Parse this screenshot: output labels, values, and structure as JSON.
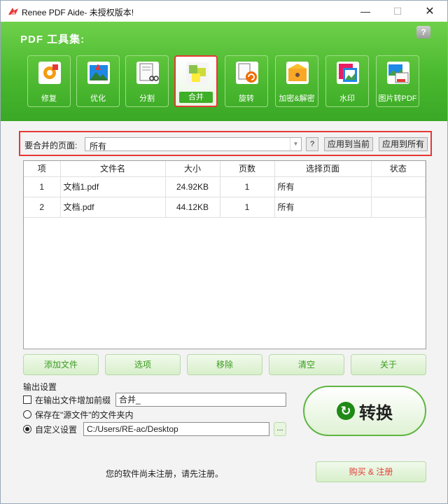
{
  "window": {
    "title": "Renee PDF Aide- 未授权版本!",
    "min_glyph": "—",
    "max_glyph": "☐",
    "close_glyph": "✕"
  },
  "header": {
    "title": "PDF 工具集:",
    "help": "?"
  },
  "tools": [
    {
      "label": "修复",
      "icon": "repair-icon",
      "active": false
    },
    {
      "label": "优化",
      "icon": "optimize-icon",
      "active": false
    },
    {
      "label": "分割",
      "icon": "split-icon",
      "active": false
    },
    {
      "label": "合并",
      "icon": "merge-icon",
      "active": true
    },
    {
      "label": "旋转",
      "icon": "rotate-icon",
      "active": false
    },
    {
      "label": "加密&解密",
      "icon": "encrypt-icon",
      "active": false
    },
    {
      "label": "水印",
      "icon": "watermark-icon",
      "active": false
    },
    {
      "label": "图片转PDF",
      "icon": "image-to-pdf-icon",
      "active": false
    }
  ],
  "pages_to_merge": {
    "label": "要合并的页面:",
    "value": "所有",
    "help": "?",
    "apply_current": "应用到当前",
    "apply_all": "应用到所有"
  },
  "file_table": {
    "columns": [
      "项",
      "文件名",
      "大小",
      "页数",
      "选择页面",
      "状态"
    ],
    "rows": [
      {
        "index": "1",
        "name": "文档1.pdf",
        "size": "24.92KB",
        "pages": "1",
        "selected_pages": "所有",
        "status": ""
      },
      {
        "index": "2",
        "name": "文档.pdf",
        "size": "44.12KB",
        "pages": "1",
        "selected_pages": "所有",
        "status": ""
      }
    ]
  },
  "actions": {
    "add_file": "添加文件",
    "options": "选项",
    "remove": "移除",
    "clear": "清空",
    "about": "关于"
  },
  "output": {
    "title": "输出设置",
    "prefix_label": "在输出文件增加前缀",
    "prefix_value": "合并_",
    "save_source_label": "保存在\"源文件\"的文件夹内",
    "custom_label": "自定义设置",
    "custom_path": "C:/Users/RE-ac/Desktop",
    "browse": "..."
  },
  "convert": {
    "label": "转换"
  },
  "footer": {
    "note": "您的软件尚未注册，请先注册。",
    "buy": "购买 & 注册"
  },
  "colors": {
    "header_green": "#49b82e",
    "highlight_red": "#e53935",
    "button_text_green": "#3a9a1f"
  }
}
